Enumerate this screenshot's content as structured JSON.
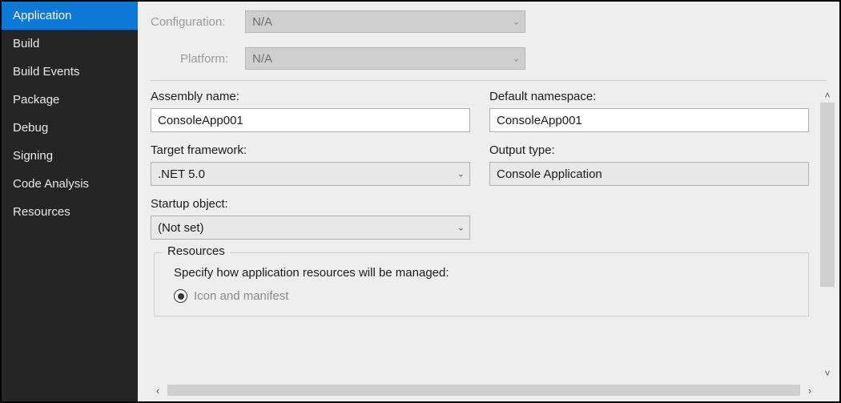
{
  "sidebar": {
    "items": [
      {
        "label": "Application",
        "active": true
      },
      {
        "label": "Build"
      },
      {
        "label": "Build Events"
      },
      {
        "label": "Package"
      },
      {
        "label": "Debug"
      },
      {
        "label": "Signing"
      },
      {
        "label": "Code Analysis"
      },
      {
        "label": "Resources"
      }
    ]
  },
  "header": {
    "configuration_label": "Configuration:",
    "configuration_value": "N/A",
    "platform_label": "Platform:",
    "platform_value": "N/A"
  },
  "fields": {
    "assembly_name_label": "Assembly name:",
    "assembly_name_value": "ConsoleApp001",
    "default_namespace_label": "Default namespace:",
    "default_namespace_value": "ConsoleApp001",
    "target_framework_label": "Target framework:",
    "target_framework_value": ".NET 5.0",
    "output_type_label": "Output type:",
    "output_type_value": "Console Application",
    "startup_object_label": "Startup object:",
    "startup_object_value": "(Not set)"
  },
  "resources": {
    "legend": "Resources",
    "description": "Specify how application resources will be managed:",
    "option1_label": "Icon and manifest",
    "option1_selected": true
  }
}
